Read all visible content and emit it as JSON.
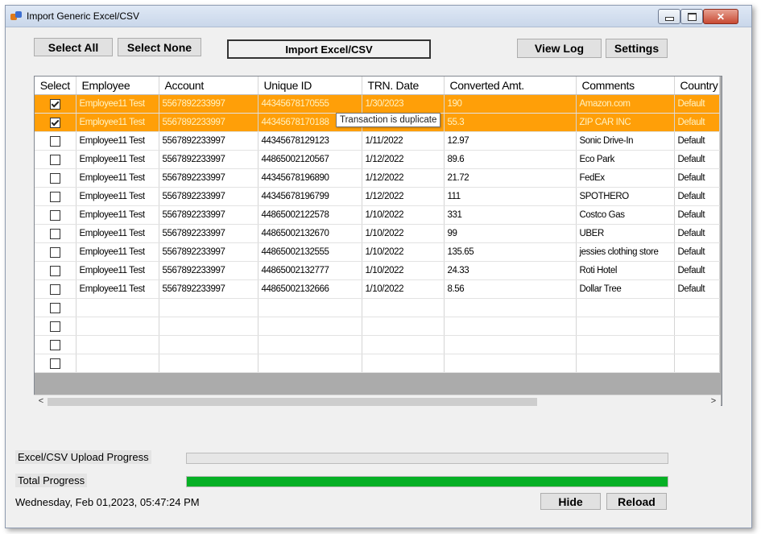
{
  "window": {
    "title": "Import Generic Excel/CSV",
    "close_label": "✕"
  },
  "toolbar": {
    "select_all": "Select All",
    "select_none": "Select None",
    "import": "Import Excel/CSV",
    "view_log": "View Log",
    "settings": "Settings"
  },
  "grid": {
    "columns": [
      "Select",
      "Employee",
      "Account",
      "Unique ID",
      "TRN. Date",
      "Converted Amt.",
      "Comments",
      "Country"
    ],
    "rows": [
      {
        "checked": true,
        "highlight": true,
        "employee": "Employee11 Test",
        "account": "5567892233997",
        "unique_id": "44345678170555",
        "trn_date": "1/30/2023",
        "amount": "190",
        "comments": "Amazon.com",
        "country": "Default"
      },
      {
        "checked": true,
        "highlight": true,
        "employee": "Employee11 Test",
        "account": "5567892233997",
        "unique_id": "44345678170188",
        "trn_date": "",
        "amount": "55.3",
        "comments": "ZIP CAR INC",
        "country": "Default"
      },
      {
        "checked": false,
        "highlight": false,
        "employee": "Employee11 Test",
        "account": "5567892233997",
        "unique_id": "44345678129123",
        "trn_date": "1/11/2022",
        "amount": "12.97",
        "comments": "Sonic Drive-In",
        "country": "Default"
      },
      {
        "checked": false,
        "highlight": false,
        "employee": "Employee11 Test",
        "account": "5567892233997",
        "unique_id": "44865002120567",
        "trn_date": "1/12/2022",
        "amount": "89.6",
        "comments": "Eco Park",
        "country": "Default"
      },
      {
        "checked": false,
        "highlight": false,
        "employee": "Employee11 Test",
        "account": "5567892233997",
        "unique_id": "44345678196890",
        "trn_date": "1/12/2022",
        "amount": "21.72",
        "comments": "FedEx",
        "country": "Default"
      },
      {
        "checked": false,
        "highlight": false,
        "employee": "Employee11 Test",
        "account": "5567892233997",
        "unique_id": "44345678196799",
        "trn_date": "1/12/2022",
        "amount": "111",
        "comments": "SPOTHERO",
        "country": "Default"
      },
      {
        "checked": false,
        "highlight": false,
        "employee": "Employee11 Test",
        "account": "5567892233997",
        "unique_id": "44865002122578",
        "trn_date": "1/10/2022",
        "amount": "331",
        "comments": "Costco Gas",
        "country": "Default"
      },
      {
        "checked": false,
        "highlight": false,
        "employee": "Employee11 Test",
        "account": "5567892233997",
        "unique_id": "44865002132670",
        "trn_date": "1/10/2022",
        "amount": "99",
        "comments": "UBER",
        "country": "Default"
      },
      {
        "checked": false,
        "highlight": false,
        "employee": "Employee11 Test",
        "account": "5567892233997",
        "unique_id": "44865002132555",
        "trn_date": "1/10/2022",
        "amount": "135.65",
        "comments": "jessies clothing store",
        "country": "Default"
      },
      {
        "checked": false,
        "highlight": false,
        "employee": "Employee11 Test",
        "account": "5567892233997",
        "unique_id": "44865002132777",
        "trn_date": "1/10/2022",
        "amount": "24.33",
        "comments": "Roti Hotel",
        "country": "Default"
      },
      {
        "checked": false,
        "highlight": false,
        "employee": "Employee11 Test",
        "account": "5567892233997",
        "unique_id": "44865002132666",
        "trn_date": "1/10/2022",
        "amount": "8.56",
        "comments": "Dollar Tree",
        "country": "Default"
      },
      {
        "checked": false,
        "highlight": false,
        "employee": "",
        "account": "",
        "unique_id": "",
        "trn_date": "",
        "amount": "",
        "comments": "",
        "country": ""
      },
      {
        "checked": false,
        "highlight": false,
        "employee": "",
        "account": "",
        "unique_id": "",
        "trn_date": "",
        "amount": "",
        "comments": "",
        "country": ""
      },
      {
        "checked": false,
        "highlight": false,
        "employee": "",
        "account": "",
        "unique_id": "",
        "trn_date": "",
        "amount": "",
        "comments": "",
        "country": ""
      },
      {
        "checked": false,
        "highlight": false,
        "employee": "",
        "account": "",
        "unique_id": "",
        "trn_date": "",
        "amount": "",
        "comments": "",
        "country": ""
      }
    ],
    "tooltip": "Transaction is duplicate",
    "scroll_left": "<",
    "scroll_right": ">"
  },
  "progress": {
    "upload_label": "Excel/CSV Upload Progress",
    "upload_value": 0,
    "total_label": "Total Progress",
    "total_value": 1.0,
    "fill_color": "#06b025"
  },
  "footer": {
    "datetime": "Wednesday, Feb 01,2023, 05:47:24 PM",
    "hide": "Hide",
    "reload": "Reload"
  },
  "colors": {
    "highlight_row": "#ff9f08",
    "highlight_text": "#fff3c4"
  }
}
